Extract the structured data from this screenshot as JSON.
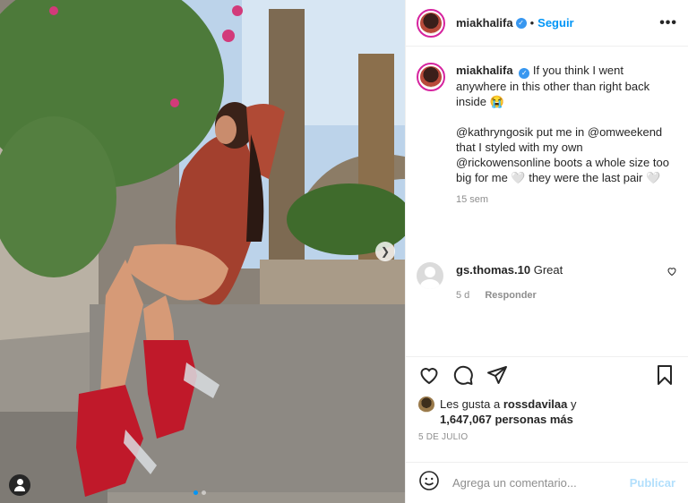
{
  "post": {
    "username": "miakhalifa",
    "follow_label": "Seguir",
    "separator": "•",
    "more_label": "•••"
  },
  "caption": {
    "username": "miakhalifa",
    "text_line1": "If you think I went anywhere in this other than right back inside 😭",
    "text_line2": "@kathryngosik put me in @omweekend that I styled with my own @rickowensonline boots a whole size too big for me 🤍 they were the last pair 🤍",
    "time": "15 sem"
  },
  "comment": {
    "username": "gs.thomas.10",
    "text": "Great",
    "time": "5 d",
    "reply_label": "Responder"
  },
  "likes": {
    "prefix": "Les gusta a ",
    "user": "rossdavilaa",
    "connector": " y",
    "count_text": "1,647,067 personas más"
  },
  "date": "5 DE JULIO",
  "add_comment": {
    "placeholder": "Agrega un comentario...",
    "publish_label": "Publicar"
  },
  "colors": {
    "accent": "#0095f6",
    "publish_disabled": "#b2dffc",
    "verified": "#3897f0"
  },
  "icons": [
    "heart-icon",
    "comment-icon",
    "share-icon",
    "bookmark-icon",
    "emoji-icon",
    "more-icon",
    "next-arrow-icon",
    "user-tag-icon",
    "verified-icon"
  ]
}
